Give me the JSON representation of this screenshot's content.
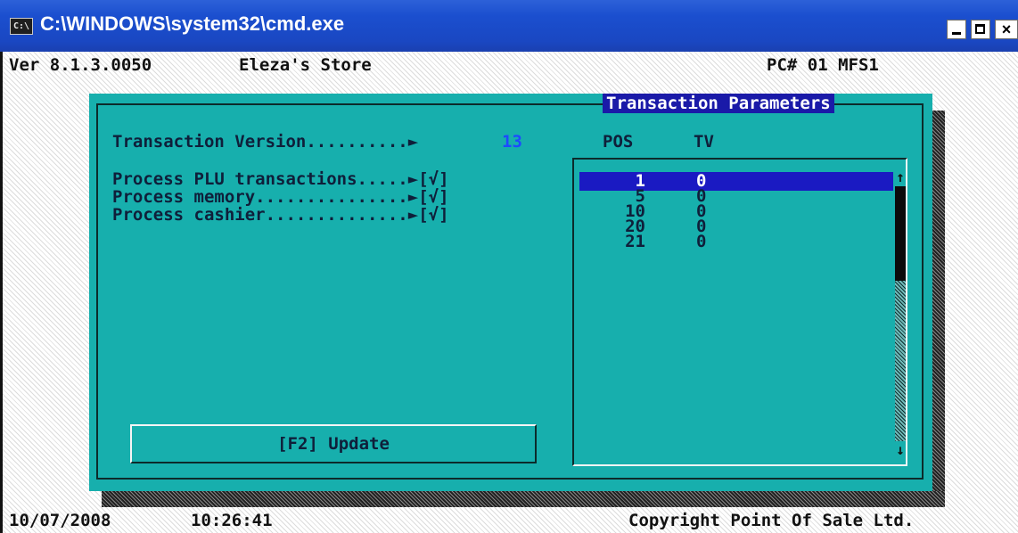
{
  "window": {
    "title": "C:\\WINDOWS\\system32\\cmd.exe",
    "icon_text": "C:\\",
    "minimize_label": "_",
    "close_label": "×"
  },
  "header": {
    "version": "Ver 8.1.3.0050",
    "store_name": "Eleza's Store",
    "pc": "PC# 01 MFS1"
  },
  "dialog": {
    "title": "Transaction Parameters",
    "transaction_version_label": "Transaction Version..........",
    "transaction_version_value": "13",
    "arrow": "►",
    "options": [
      {
        "label": "Process PLU transactions.....",
        "checkbox": "[√]"
      },
      {
        "label": "Process memory...............",
        "checkbox": "[√]"
      },
      {
        "label": "Process cashier..............",
        "checkbox": "[√]"
      }
    ],
    "table": {
      "columns": [
        "POS",
        "TV"
      ],
      "rows": [
        {
          "pos": "1",
          "tv": "0",
          "selected": true
        },
        {
          "pos": "5",
          "tv": "0"
        },
        {
          "pos": "10",
          "tv": "0"
        },
        {
          "pos": "20",
          "tv": "0"
        },
        {
          "pos": "21",
          "tv": "0"
        }
      ]
    },
    "update_button": "[F2] Update",
    "scroll_up": "↑",
    "scroll_down": "↓"
  },
  "footer": {
    "date": "10/07/2008",
    "time": "10:26:41",
    "copyright": "Copyright Point Of Sale Ltd."
  },
  "colors": {
    "dialog_bg": "#17afad",
    "title_bar": "#1b4fcf",
    "selection": "#1a1ac2",
    "value_blue": "#1e4bff"
  }
}
